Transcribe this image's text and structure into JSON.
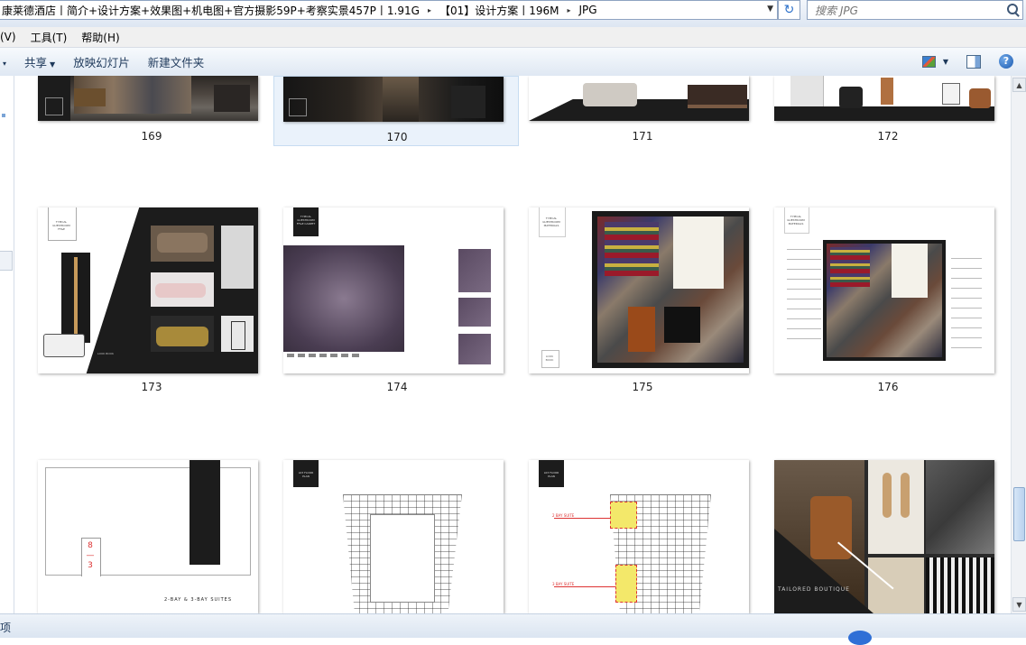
{
  "address": {
    "crumbs": [
      "康莱德酒店丨简介+设计方案+效果图+机电图+官方摄影59P+考察实景457P丨1.91G",
      "【01】设计方案丨196M",
      "JPG"
    ],
    "separator": "▸"
  },
  "search": {
    "placeholder": "搜索 JPG"
  },
  "menu": {
    "items": [
      "(V)",
      "工具(T)",
      "帮助(H)"
    ]
  },
  "toolbar": {
    "organize_caret": "▾",
    "items": [
      "共享",
      "放映幻灯片",
      "新建文件夹"
    ]
  },
  "icons": {
    "refresh": "refresh-icon",
    "search": "search-icon",
    "view": "view-options-icon",
    "pane": "preview-pane-icon",
    "help": "help-icon",
    "help_glyph": "?"
  },
  "files": [
    {
      "name": "169",
      "kind": "dark-lobby"
    },
    {
      "name": "170",
      "kind": "dark-corridor",
      "selected": true
    },
    {
      "name": "171",
      "kind": "furniture-white"
    },
    {
      "name": "172",
      "kind": "furniture-chair"
    },
    {
      "name": "173",
      "kind": "ffe-board"
    },
    {
      "name": "174",
      "kind": "carpet"
    },
    {
      "name": "175",
      "kind": "materials"
    },
    {
      "name": "176",
      "kind": "materials-annotated"
    },
    {
      "name": "177",
      "kind": "suites-diagram"
    },
    {
      "name": "178",
      "kind": "floor-plan"
    },
    {
      "name": "179",
      "kind": "floor-plan-highlight"
    },
    {
      "name": "180",
      "kind": "tailored-boutique"
    }
  ],
  "thumb_text": {
    "lookbook": "LOOK BOOK",
    "typical_ffe": "TYPICAL GUESTROOM FF&E",
    "typical_carpet": "TYPICAL GUESTROOM FF&E CARPET",
    "typical_materials": "TYPICAL GUESTROOM MATERIALS",
    "suites": "2-BAY & 3-BAY SUITES",
    "suites_marks": "8\n—\n3",
    "floor_plan": "L03 FLOOR PLAN",
    "suite_a": "2 BAY SUITE",
    "suite_b": "3 BAY SUITE",
    "boutique": "TAILORED BOUTIQUE"
  },
  "status": {
    "text": "项"
  }
}
